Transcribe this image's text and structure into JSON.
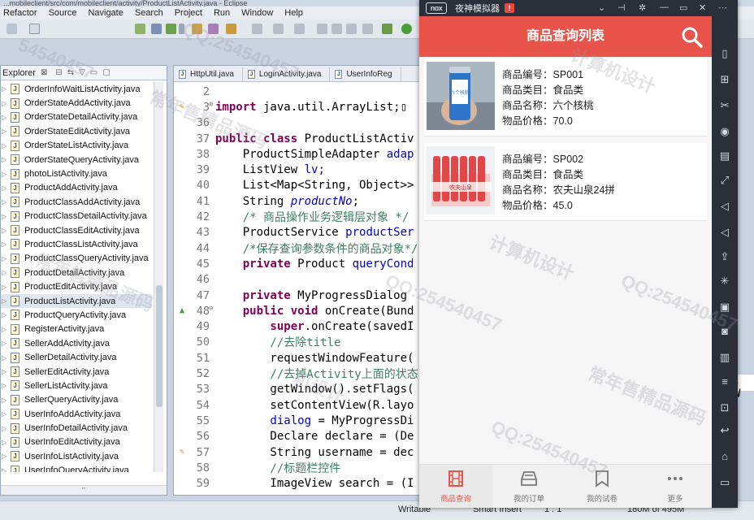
{
  "eclipse": {
    "title": "...mobileclient/src/com/mobileclient/activity/ProductListActivity.java - Eclipse",
    "menu": [
      "Refactor",
      "Source",
      "Navigate",
      "Search",
      "Project",
      "Run",
      "Window",
      "Help"
    ],
    "explorer": {
      "tab_label": "Explorer",
      "close_glyph": "⊠",
      "files": [
        "OrderInfoWaitListActivity.java",
        "OrderStateAddActivity.java",
        "OrderStateDetailActivity.java",
        "OrderStateEditActivity.java",
        "OrderStateListActivity.java",
        "OrderStateQueryActivity.java",
        "photoListActivity.java",
        "ProductAddActivity.java",
        "ProductClassAddActivity.java",
        "ProductClassDetailActivity.java",
        "ProductClassEditActivity.java",
        "ProductClassListActivity.java",
        "ProductClassQueryActivity.java",
        "ProductDetailActivity.java",
        "ProductEditActivity.java",
        "ProductListActivity.java",
        "ProductQueryActivity.java",
        "RegisterActivity.java",
        "SellerAddActivity.java",
        "SellerDetailActivity.java",
        "SellerEditActivity.java",
        "SellerListActivity.java",
        "SellerQueryActivity.java",
        "UserInfoAddActivity.java",
        "UserInfoDetailActivity.java",
        "UserInfoEditActivity.java",
        "UserInfoListActivity.java",
        "UserInfoQueryActivity.java"
      ],
      "selected_index": 15,
      "hscroll_label": "'''"
    },
    "editor": {
      "tabs": [
        "HttpUtil.java",
        "LoginActivity.java",
        "UserInfoReg"
      ],
      "lines": [
        {
          "n": "2",
          "mark": "",
          "parts": [
            [
              "",
              ""
            ]
          ]
        },
        {
          "n": "3",
          "mark": "bulb",
          "fold": "⊕",
          "parts": [
            [
              "kw",
              "import"
            ],
            [
              "",
              " java.util.ArrayList;▯"
            ]
          ]
        },
        {
          "n": "36",
          "mark": "",
          "parts": [
            [
              "",
              ""
            ]
          ]
        },
        {
          "n": "37",
          "mark": "",
          "parts": [
            [
              "kw",
              "public class"
            ],
            [
              "",
              " ProductListActiv"
            ]
          ]
        },
        {
          "n": "38",
          "mark": "",
          "parts": [
            [
              "",
              "    ProductSimpleAdapter "
            ],
            [
              "fld",
              "adap"
            ]
          ]
        },
        {
          "n": "39",
          "mark": "",
          "parts": [
            [
              "",
              "    ListView "
            ],
            [
              "fld",
              "lv"
            ],
            [
              "",
              ";"
            ]
          ]
        },
        {
          "n": "40",
          "mark": "",
          "parts": [
            [
              "",
              "    List<Map<String, Object>>"
            ]
          ]
        },
        {
          "n": "41",
          "mark": "",
          "parts": [
            [
              "",
              "    String "
            ],
            [
              "fld",
              "productNo"
            ],
            [
              "",
              ";"
            ]
          ]
        },
        {
          "n": "42",
          "mark": "",
          "parts": [
            [
              "cm",
              "    /* 商品操作业务逻辑层对象 */"
            ]
          ]
        },
        {
          "n": "43",
          "mark": "",
          "parts": [
            [
              "",
              "    ProductService "
            ],
            [
              "fld",
              "productSer"
            ]
          ]
        },
        {
          "n": "44",
          "mark": "",
          "parts": [
            [
              "cm",
              "    /*保存查询参数条件的商品对象*/"
            ]
          ]
        },
        {
          "n": "45",
          "mark": "",
          "parts": [
            [
              "kw",
              "    private"
            ],
            [
              "",
              " Product "
            ],
            [
              "fld",
              "queryCond"
            ]
          ]
        },
        {
          "n": "46",
          "mark": "",
          "parts": [
            [
              "",
              ""
            ]
          ]
        },
        {
          "n": "47",
          "mark": "",
          "parts": [
            [
              "kw",
              "    private"
            ],
            [
              "",
              " MyProgressDialog"
            ]
          ]
        },
        {
          "n": "48",
          "mark": "override",
          "fold": "⊖",
          "parts": [
            [
              "kw",
              "    public void"
            ],
            [
              "",
              " onCreate(Bund"
            ]
          ]
        },
        {
          "n": "49",
          "mark": "",
          "parts": [
            [
              "kw",
              "        super"
            ],
            [
              "",
              ".onCreate(savedI"
            ]
          ]
        },
        {
          "n": "50",
          "mark": "",
          "parts": [
            [
              "cm",
              "        //去除title"
            ]
          ]
        },
        {
          "n": "51",
          "mark": "",
          "parts": [
            [
              "",
              "        requestWindowFeature("
            ]
          ]
        },
        {
          "n": "52",
          "mark": "",
          "parts": [
            [
              "cm",
              "        //去掉Activity上面的状态"
            ]
          ]
        },
        {
          "n": "53",
          "mark": "",
          "parts": [
            [
              "",
              "        getWindow().setFlags("
            ]
          ]
        },
        {
          "n": "54",
          "mark": "",
          "parts": [
            [
              "",
              "        setContentView(R.layo"
            ]
          ]
        },
        {
          "n": "55",
          "mark": "",
          "parts": [
            [
              "fld",
              "        dialog"
            ],
            [
              "",
              " = MyProgressDi"
            ]
          ]
        },
        {
          "n": "56",
          "mark": "",
          "parts": [
            [
              "",
              "        Declare declare = (De"
            ]
          ]
        },
        {
          "n": "57",
          "mark": "bulb",
          "parts": [
            [
              "",
              "        String username = dec"
            ]
          ]
        },
        {
          "n": "58",
          "mark": "",
          "parts": [
            [
              "cm",
              "        //标题栏控件"
            ]
          ]
        },
        {
          "n": "59",
          "mark": "",
          "parts": [
            [
              "",
              "        ImageView search = (I"
            ]
          ]
        }
      ]
    },
    "right_edge_code": ", W",
    "status": {
      "writable": "Writable",
      "insert": "Smart Insert",
      "position": "1 : 1",
      "memory": "180M of 495M"
    }
  },
  "emulator": {
    "logo": "nox",
    "name": "夜神模拟器",
    "badge": "!",
    "app": {
      "title": "商品查询列表",
      "products": [
        {
          "no_label": "商品编号：",
          "no": "SP001",
          "class_label": "商品类目：",
          "class": "食品类",
          "name_label": "商品名称：",
          "name": "六个核桃",
          "price_label": "物品价格：",
          "price": "70.0",
          "img_text": "六个核桃"
        },
        {
          "no_label": "商品编号：",
          "no": "SP002",
          "class_label": "商品类目：",
          "class": "食品类",
          "name_label": "商品名称：",
          "name": "农夫山泉24拼",
          "price_label": "物品价格：",
          "price": "45.0",
          "img_text": "农夫山泉"
        }
      ],
      "nav": [
        "商品查询",
        "我的订单",
        "我的试卷",
        "更多"
      ],
      "nav_active": 0
    }
  },
  "watermarks": [
    "QQ:254540457",
    "常年售精品源码",
    "计算机设计",
    "54540457",
    "QQ:254540457",
    "常年售精品源码",
    "计算机设计",
    "QQ:254540457",
    "常年售精品源码",
    "机设计",
    "QQ:254540457"
  ],
  "colors": {
    "app_red": "#e8544a",
    "emu_frame": "#2b2f3a",
    "keyword": "#7f0055",
    "comment": "#3f7f5f",
    "field": "#0000c0"
  }
}
